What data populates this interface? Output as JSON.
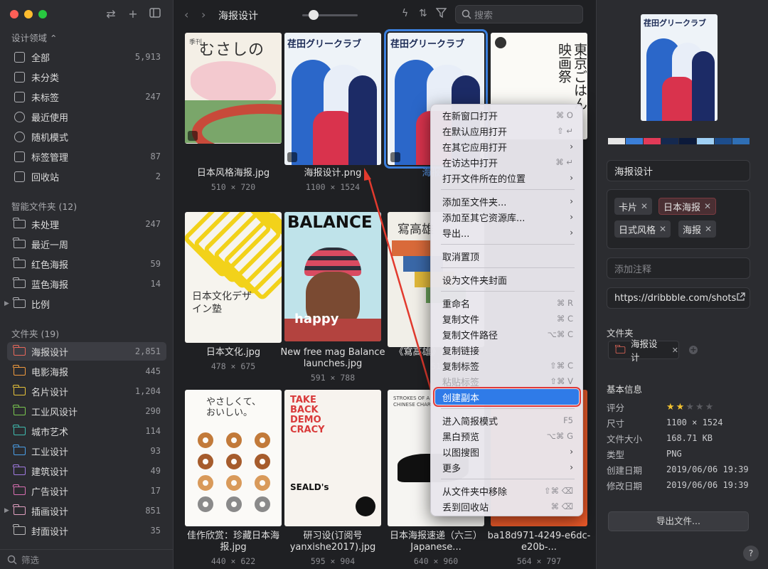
{
  "sidebar": {
    "section_domain": "设计领域 ⌃",
    "system_items": [
      {
        "label": "全部",
        "count": "5,913",
        "icon": "all-icon"
      },
      {
        "label": "未分类",
        "count": "",
        "icon": "unsorted-icon"
      },
      {
        "label": "未标签",
        "count": "247",
        "icon": "untagged-icon"
      },
      {
        "label": "最近使用",
        "count": "",
        "icon": "clock-icon"
      },
      {
        "label": "随机模式",
        "count": "",
        "icon": "bulb-icon"
      },
      {
        "label": "标签管理",
        "count": "87",
        "icon": "tag-icon"
      },
      {
        "label": "回收站",
        "count": "2",
        "icon": "trash-icon"
      }
    ],
    "section_smart": "智能文件夹 (12)",
    "smart_items": [
      {
        "label": "未处理",
        "count": "247"
      },
      {
        "label": "最近一周",
        "count": ""
      },
      {
        "label": "红色海报",
        "count": "59"
      },
      {
        "label": "蓝色海报",
        "count": "14"
      },
      {
        "label": "比例",
        "count": ""
      }
    ],
    "section_folders": "文件夹 (19)",
    "folders": [
      {
        "label": "海报设计",
        "count": "2,851",
        "color": "#e8685a",
        "active": true
      },
      {
        "label": "电影海报",
        "count": "445",
        "color": "#f09a3e"
      },
      {
        "label": "名片设计",
        "count": "1,204",
        "color": "#e8c33a"
      },
      {
        "label": "工业风设计",
        "count": "290",
        "color": "#7ac74f"
      },
      {
        "label": "城市艺术",
        "count": "114",
        "color": "#3fbcb0"
      },
      {
        "label": "工业设计",
        "count": "93",
        "color": "#4a9fe8"
      },
      {
        "label": "建筑设计",
        "count": "49",
        "color": "#a07ae0"
      },
      {
        "label": "广告设计",
        "count": "17",
        "color": "#d86fb1"
      },
      {
        "label": "插画设计",
        "count": "851",
        "color": "#e0a0c0"
      },
      {
        "label": "封面设计",
        "count": "35",
        "color": "#b8b8b8"
      }
    ],
    "filter_placeholder": "筛选"
  },
  "toolbar": {
    "title": "海报设计",
    "search_placeholder": "搜索",
    "zoom_level": 0.2
  },
  "cards": [
    {
      "name": "日本风格海报.jpg",
      "dims": "510 × 720",
      "poster": "musashino",
      "poster_text": "むさしの",
      "poster_sub": "季刊"
    },
    {
      "name": "海报设计.png",
      "dims": "1100 × 1524",
      "poster": "sakata",
      "poster_text": "荏田グリークラブ"
    },
    {
      "name": "海报设",
      "dims": "",
      "poster": "sakata",
      "poster_text": "荏田グリークラブ",
      "selected": true
    },
    {
      "name": "",
      "dims": "",
      "poster": "tokyo",
      "poster_text": "東京ごはん映画祭"
    },
    {
      "name": "日本文化.jpg",
      "dims": "478 × 675",
      "poster": "culture",
      "poster_text": "日本文化デザイン塾"
    },
    {
      "name": "New free mag Balance launches.jpg",
      "dims": "591 × 788",
      "poster": "balance",
      "poster_text": "BALANCE",
      "poster_sub": "happy"
    },
    {
      "name": "《寫高雄》調查徵件",
      "dims": "51",
      "poster": "kaohsiung",
      "poster_text": "寫高雄"
    },
    {
      "name": "",
      "dims": "",
      "poster": "none"
    },
    {
      "name": "佳作欣赏：珍藏日本海报.jpg",
      "dims": "440 × 622",
      "poster": "donut",
      "poster_text": "やさしくて、おいしい。"
    },
    {
      "name": "研习设(订阅号yanxishe2017).jpg",
      "dims": "595 × 904",
      "poster": "takeback",
      "poster_text": "TAKE BACK DEMO CRACY",
      "poster_sub": "SEALD's"
    },
    {
      "name": "日本海报速递（六三） Japanese...",
      "dims": "640 × 960",
      "poster": "strokes",
      "poster_text": "STROKES OF A CHINESE CHARACTER"
    },
    {
      "name": "ba18d971-4249-e6dc-e20b-...",
      "dims": "564 × 797",
      "poster": "orange"
    }
  ],
  "context_menu": {
    "items": [
      {
        "label": "在新窗口打开",
        "shortcut": "⌘ O"
      },
      {
        "label": "在默认应用打开",
        "shortcut": "⇧ ↵"
      },
      {
        "label": "在其它应用打开",
        "arrow": true
      },
      {
        "label": "在访达中打开",
        "shortcut": "⌘ ↵"
      },
      {
        "label": "打开文件所在的位置",
        "arrow": true,
        "sep_after": true
      },
      {
        "label": "添加至文件夹...",
        "arrow": true
      },
      {
        "label": "添加至其它资源库...",
        "arrow": true
      },
      {
        "label": "导出...",
        "arrow": true,
        "sep_after": true
      },
      {
        "label": "取消置顶",
        "sep_after": true
      },
      {
        "label": "设为文件夹封面",
        "sep_after": true
      },
      {
        "label": "重命名",
        "shortcut": "⌘ R"
      },
      {
        "label": "复制文件",
        "shortcut": "⌘ C"
      },
      {
        "label": "复制文件路径",
        "shortcut": "⌥⌘ C"
      },
      {
        "label": "复制链接"
      },
      {
        "label": "复制标签",
        "shortcut": "⇧⌘ C"
      },
      {
        "label": "粘贴标签",
        "shortcut": "⇧⌘ V",
        "disabled": true
      },
      {
        "label": "创建副本",
        "highlighted": true,
        "sep_after": true
      },
      {
        "label": "进入简报模式",
        "shortcut": "F5"
      },
      {
        "label": "黑白预览",
        "shortcut": "⌥⌘ G"
      },
      {
        "label": "以图搜图",
        "arrow": true
      },
      {
        "label": "更多",
        "arrow": true,
        "sep_after": true
      },
      {
        "label": "从文件夹中移除",
        "shortcut": "⇧⌘ ⌫"
      },
      {
        "label": "丢到回收站",
        "shortcut": "⌘ ⌫"
      }
    ]
  },
  "inspector": {
    "preview_text": "荏田グリークラブ",
    "palette": [
      "#e6e6e6",
      "#3b7fd8",
      "#e23a58",
      "#15294f",
      "#0c1a3a",
      "#9fd0f5",
      "#1d4d8c",
      "#2f6fb5"
    ],
    "title_value": "海报设计",
    "tags": [
      {
        "label": "卡片",
        "highlight": false
      },
      {
        "label": "日本海报",
        "highlight": true
      },
      {
        "label": "日式风格",
        "highlight": false
      },
      {
        "label": "海报",
        "highlight": false
      }
    ],
    "note_placeholder": "添加注释",
    "url_value": "https://dribbble.com/shots",
    "folder_heading": "文件夹",
    "folder_chip": "海报设计",
    "basic_heading": "基本信息",
    "info": [
      {
        "key": "评分",
        "value": ""
      },
      {
        "key": "尺寸",
        "value": "1100 × 1524"
      },
      {
        "key": "文件大小",
        "value": "168.71 KB"
      },
      {
        "key": "类型",
        "value": "PNG"
      },
      {
        "key": "创建日期",
        "value": "2019/06/06 19:39"
      },
      {
        "key": "修改日期",
        "value": "2019/06/06 19:39"
      }
    ],
    "rating": 2,
    "rating_max": 5,
    "export_label": "导出文件...",
    "help_label": "?"
  }
}
